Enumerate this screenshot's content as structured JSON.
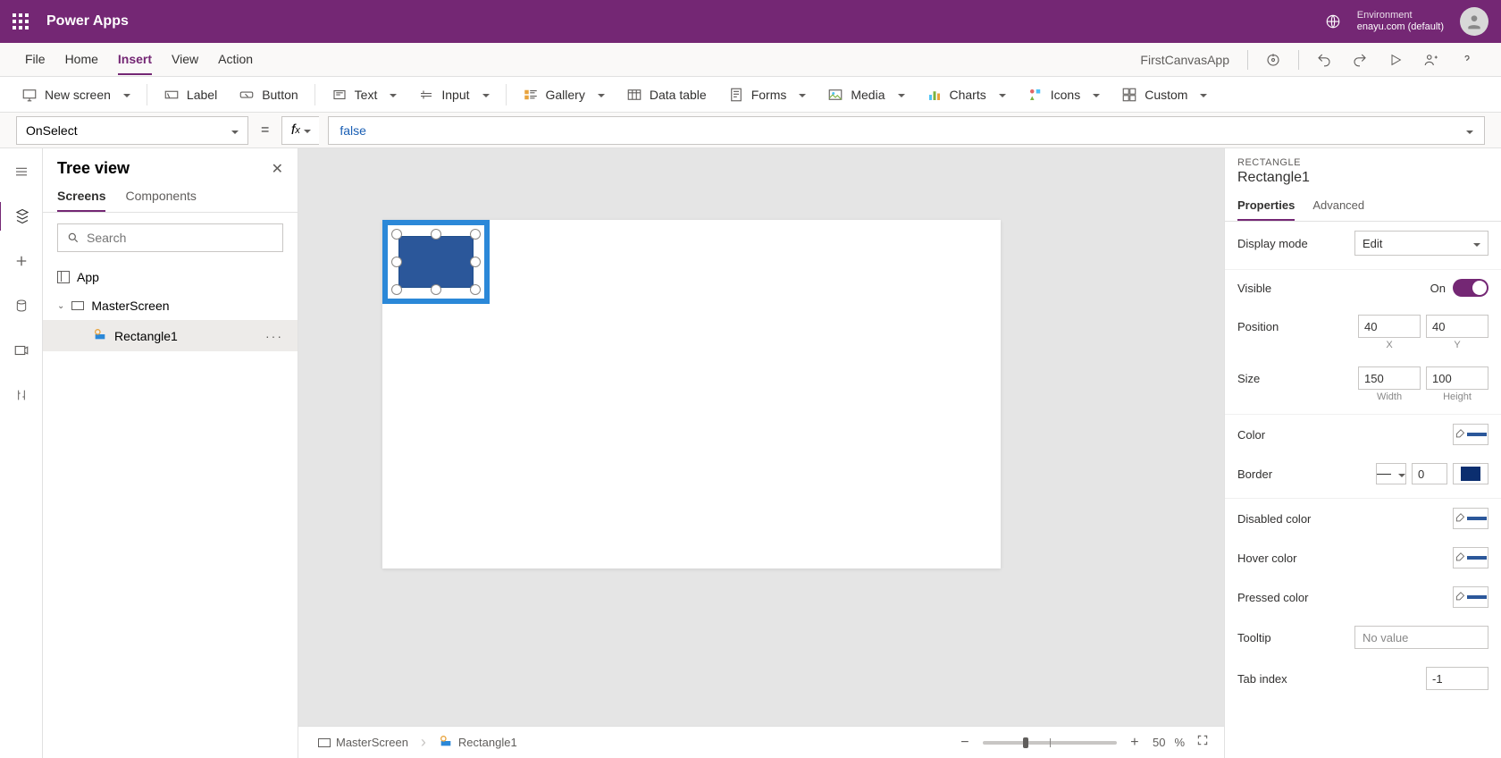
{
  "titlebar": {
    "app_name": "Power Apps",
    "env_label": "Environment",
    "env_value": "enayu.com (default)"
  },
  "menubar": {
    "items": [
      "File",
      "Home",
      "Insert",
      "View",
      "Action"
    ],
    "active_index": 2,
    "app_name": "FirstCanvasApp"
  },
  "ribbon": {
    "new_screen": "New screen",
    "label": "Label",
    "button": "Button",
    "text": "Text",
    "input": "Input",
    "gallery": "Gallery",
    "data_table": "Data table",
    "forms": "Forms",
    "media": "Media",
    "charts": "Charts",
    "icons": "Icons",
    "custom": "Custom"
  },
  "formula": {
    "property": "OnSelect",
    "value": "false"
  },
  "tree": {
    "title": "Tree view",
    "tabs": [
      "Screens",
      "Components"
    ],
    "active_tab": 0,
    "search_placeholder": "Search",
    "app_label": "App",
    "screen_label": "MasterScreen",
    "shape_label": "Rectangle1"
  },
  "breadcrumb": {
    "screen": "MasterScreen",
    "shape": "Rectangle1"
  },
  "zoom": {
    "percent": "50",
    "unit": "%"
  },
  "props": {
    "type": "RECTANGLE",
    "name": "Rectangle1",
    "tabs": [
      "Properties",
      "Advanced"
    ],
    "active_tab": 0,
    "display_mode_label": "Display mode",
    "display_mode_value": "Edit",
    "visible_label": "Visible",
    "visible_value": "On",
    "position_label": "Position",
    "pos_x": "40",
    "pos_y": "40",
    "pos_x_lbl": "X",
    "pos_y_lbl": "Y",
    "size_label": "Size",
    "size_w": "150",
    "size_h": "100",
    "size_w_lbl": "Width",
    "size_h_lbl": "Height",
    "color_label": "Color",
    "border_label": "Border",
    "border_width": "0",
    "disabled_color_label": "Disabled color",
    "hover_color_label": "Hover color",
    "pressed_color_label": "Pressed color",
    "tooltip_label": "Tooltip",
    "tooltip_placeholder": "No value",
    "tabindex_label": "Tab index",
    "tabindex_value": "-1"
  }
}
